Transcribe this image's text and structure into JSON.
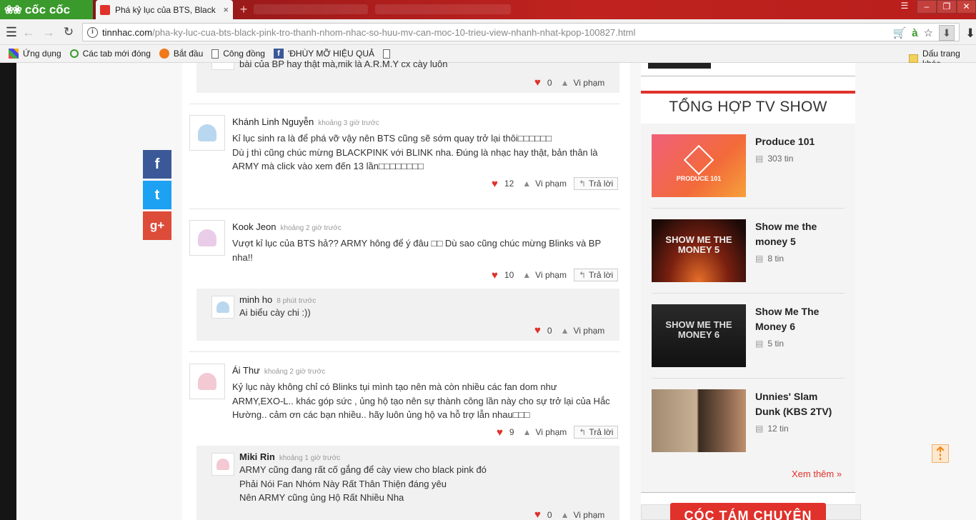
{
  "browser": {
    "logo_text": "cốc cốc",
    "tab_title": "Phá kỷ lục của BTS, Black P",
    "tab_close": "×",
    "new_tab": "+",
    "url_domain": "tinnhac.com",
    "url_path": "/pha-ky-luc-cua-bts-black-pink-tro-thanh-nhom-nhac-so-huu-mv-can-moc-10-trieu-view-nhanh-nhat-kpop-100827.html",
    "adot": "à"
  },
  "bookmarks": [
    {
      "label": "Ứng dụng"
    },
    {
      "label": "Các tab mới đóng"
    },
    {
      "label": "Bắt đầu"
    },
    {
      "label": "Công đồng"
    },
    {
      "label": "'ĐHÙY MỠ HIỆU QUẢ"
    },
    {
      "label": ""
    }
  ],
  "bookmark_folder": "Dấu trang khác",
  "share": {
    "fb": "f",
    "tw": "t",
    "gp": "g+"
  },
  "comments": {
    "c0": {
      "text": "bài của BP hay thật mà,mik là A.R.M.Y cx cày luôn",
      "likes": "0",
      "report": "Vi phạm"
    },
    "c1": {
      "name": "Khánh Linh Nguyễn",
      "time": "khoảng 3 giờ trước",
      "line1": "Kỉ lục sinh ra là để phá vỡ vậy nên BTS cũng sẽ sớm quay trở lại thôi□□□□□□",
      "line2": "Dù j thì cũng chúc mừng BLACKPINK với BLINK nha. Đúng là nhạc hay thật, bản thân là",
      "line3": "ARMY mà click vào xem đến 13 lần□□□□□□□□",
      "likes": "12",
      "report": "Vi phạm",
      "reply": "Trả lời"
    },
    "c2": {
      "name": "Kook Jeon",
      "time": "khoảng 2 giờ trước",
      "line1": "Vượt kỉ lục của BTS hả?? ARMY hông để ý đâu □□ Dù sao cũng chúc mừng Blinks và BP",
      "line2": "nha!!",
      "likes": "10",
      "report": "Vi phạm",
      "reply": "Trả lời"
    },
    "c2r": {
      "name": "minh ho",
      "time": "8 phút trước",
      "line1": "Ai biểu cày chi :))",
      "likes": "0",
      "report": "Vi phạm"
    },
    "c3": {
      "name": "Ái Thư",
      "time": "khoảng 2 giờ trước",
      "line1": "Kỷ lục này không chỉ có Blinks tụi mình tạo nên mà còn nhiều các fan dom như",
      "line2": "ARMY,EXO-L.. khác góp sức , ủng hộ tạo nên sự thành công lần này cho sự trở lại của Hắc",
      "line3": "Hường.. cảm ơn các bạn nhiều.. hãy luôn ủng hộ va hỗ trợ lẫn nhau□□□",
      "likes": "9",
      "report": "Vi phạm",
      "reply": "Trả lời"
    },
    "c3r": {
      "name": "Miki Rin",
      "time": "khoảng 1 giờ trước",
      "line1": "ARMY cũng đang rất cố gắng để cày view cho black pink đó",
      "line2": "Phải Nói Fan Nhóm Này Rất Thân Thiện đáng yêu",
      "line3": "Nên ARMY cũng ủng Hộ Rất Nhiều Nha",
      "likes": "0",
      "report": "Vi phạm"
    }
  },
  "sidebar": {
    "title": "TỔNG HỢP TV SHOW",
    "shows": [
      {
        "title": "Produce 101",
        "count": "303 tin",
        "thumb_text": "PRODUCE 101"
      },
      {
        "title": "Show me the money 5",
        "count": "8 tin",
        "thumb_text": "SHOW ME THE MONEY 5"
      },
      {
        "title": "Show Me The Money 6",
        "count": "5 tin",
        "thumb_text": "SHOW ME THE MONEY 6"
      },
      {
        "title": "Unnies' Slam Dunk (KBS 2TV)",
        "count": "12 tin",
        "thumb_text": ""
      }
    ],
    "more": "Xem thêm »",
    "coc_button": "CÓC TÁM CHUYỆN"
  }
}
